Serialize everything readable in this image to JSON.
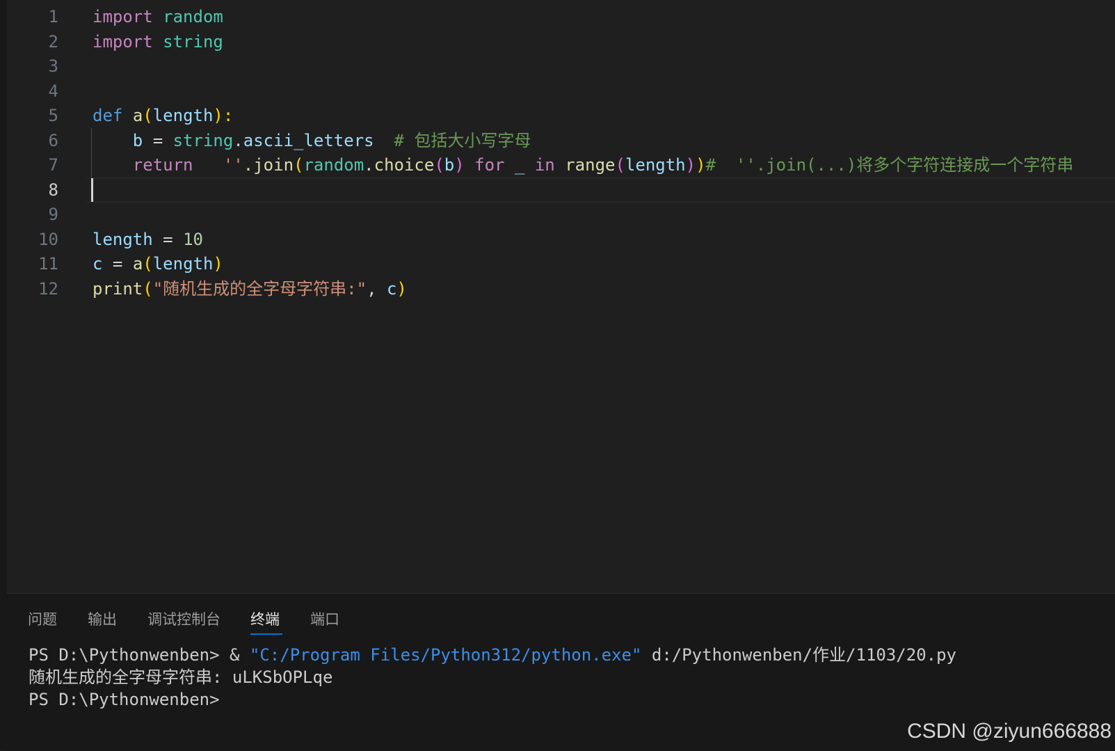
{
  "editor": {
    "line_numbers": [
      "1",
      "2",
      "3",
      "4",
      "5",
      "6",
      "7",
      "8",
      "9",
      "10",
      "11",
      "12"
    ],
    "lines": {
      "l1": {
        "kw": "import",
        "mod": "random"
      },
      "l2": {
        "kw": "import",
        "mod": "string"
      },
      "l5": {
        "def": "def",
        "fn": "a",
        "p1": "(",
        "arg": "length",
        "p2": "):"
      },
      "l6": {
        "var": "b",
        "op": " = ",
        "mod": "string",
        "dot": ".",
        "attr": "ascii_letters",
        "comment": "# 包括大小写字母"
      },
      "l7": {
        "ret": "return",
        "str": "''",
        "join": ".join",
        "pa": "(",
        "mod": "random",
        "dot": ".",
        "choice": "choice",
        "pb": "(",
        "b": "b",
        "pc": ")",
        "for_kw": "for",
        "under": "_",
        "in_kw": "in",
        "range": "range",
        "pd": "(",
        "len": "length",
        "pe": ")",
        "pf": ")",
        "comment": "#  ''.join(...)将多个字符连接成一个字符串"
      },
      "l10": {
        "var": "length",
        "op": " = ",
        "num": "10"
      },
      "l11": {
        "var": "c",
        "op": " = ",
        "fn": "a",
        "pa": "(",
        "arg": "length",
        "pb": ")"
      },
      "l12": {
        "fn": "print",
        "pa": "(",
        "str": "\"随机生成的全字母字符串:\"",
        "comma": ", ",
        "arg": "c",
        "pb": ")"
      }
    }
  },
  "panel": {
    "tabs": [
      "问题",
      "输出",
      "调试控制台",
      "终端",
      "端口"
    ],
    "active_tab": "终端",
    "terminal": {
      "line1_prompt": "PS D:\\Pythonwenben> & ",
      "line1_exe": "\"C:/Program Files/Python312/python.exe\"",
      "line1_path": " d:/Pythonwenben/作业/1103/20.py",
      "line2": "随机生成的全字母字符串: uLKSbOPLqe",
      "line3": "PS D:\\Pythonwenben>"
    }
  },
  "watermark": "CSDN @ziyun666888",
  "colors": {
    "keyword": "#c586c0",
    "def": "#569cd6",
    "module": "#4ec9b0",
    "function": "#dcdcaa",
    "variable": "#9cdcfe",
    "string": "#ce9178",
    "number": "#b5cea8",
    "comment": "#6a9955"
  }
}
